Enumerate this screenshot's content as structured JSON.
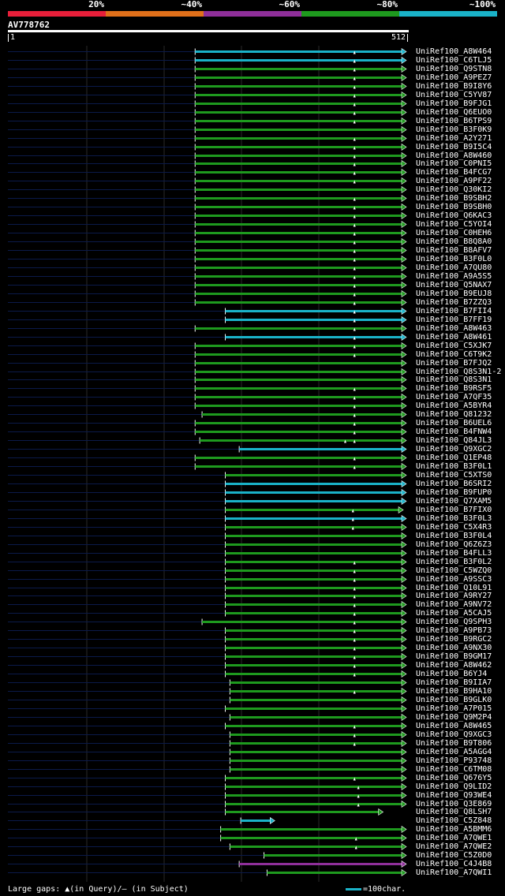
{
  "legend": {
    "segments": [
      {
        "label": "20%",
        "color": "#e81f3a"
      },
      {
        "label": "~40%",
        "color": "#e0701a"
      },
      {
        "label": "~60%",
        "color": "#8f2f9a"
      },
      {
        "label": "~80%",
        "color": "#1e9a1e"
      },
      {
        "label": "~100%",
        "color": "#1ab2c8"
      }
    ]
  },
  "query": {
    "id": "AV778762",
    "start": "1",
    "end": "512",
    "length": 512
  },
  "footer": {
    "gaps_text": "Large gaps: ▲(in Query)/– (in Subject)",
    "scale_text": "=100char."
  },
  "colors": {
    "cyan": "#1ab2c8",
    "green": "#1e9a1e",
    "magenta": "#8f2f9a",
    "gap": "#0b1a4a"
  },
  "hits": [
    {
      "id": "UniRef100_A8W464",
      "s": 242,
      "c": "cyan",
      "m": [
        448
      ]
    },
    {
      "id": "UniRef100_C6TLJ5",
      "s": 242,
      "c": "cyan",
      "m": [
        448
      ]
    },
    {
      "id": "UniRef100_Q9STN8",
      "s": 242,
      "c": "green",
      "m": [
        448
      ]
    },
    {
      "id": "UniRef100_A9PEZ7",
      "s": 242,
      "c": "green",
      "m": [
        448
      ]
    },
    {
      "id": "UniRef100_B9I8Y6",
      "s": 242,
      "c": "green",
      "m": [
        448
      ]
    },
    {
      "id": "UniRef100_C5YV87",
      "s": 242,
      "c": "green",
      "m": [
        448
      ]
    },
    {
      "id": "UniRef100_B9FJG1",
      "s": 242,
      "c": "green",
      "m": [
        448
      ]
    },
    {
      "id": "UniRef100_Q6EUO0",
      "s": 242,
      "c": "green",
      "m": [
        448
      ]
    },
    {
      "id": "UniRef100_B6TPS9",
      "s": 242,
      "c": "green",
      "m": [
        448
      ]
    },
    {
      "id": "UniRef100_B3F0K9",
      "s": 242,
      "c": "green",
      "m": []
    },
    {
      "id": "UniRef100_A2Y271",
      "s": 242,
      "c": "green",
      "m": [
        448
      ]
    },
    {
      "id": "UniRef100_B9I5C4",
      "s": 242,
      "c": "green",
      "m": [
        448
      ]
    },
    {
      "id": "UniRef100_A8W460",
      "s": 242,
      "c": "green",
      "m": [
        448
      ]
    },
    {
      "id": "UniRef100_C0PNI5",
      "s": 242,
      "c": "green",
      "m": [
        448
      ]
    },
    {
      "id": "UniRef100_B4FCG7",
      "s": 242,
      "c": "green",
      "m": [
        448
      ]
    },
    {
      "id": "UniRef100_A9PF22",
      "s": 242,
      "c": "green",
      "m": [
        448
      ]
    },
    {
      "id": "UniRef100_Q30KI2",
      "s": 242,
      "c": "green",
      "m": []
    },
    {
      "id": "UniRef100_B9SBH2",
      "s": 242,
      "c": "green",
      "m": [
        448
      ]
    },
    {
      "id": "UniRef100_B9SBH0",
      "s": 242,
      "c": "green",
      "m": [
        448
      ]
    },
    {
      "id": "UniRef100_Q6KAC3",
      "s": 242,
      "c": "green",
      "m": [
        448
      ]
    },
    {
      "id": "UniRef100_C5YOI4",
      "s": 242,
      "c": "green",
      "m": [
        448
      ]
    },
    {
      "id": "UniRef100_C0HEH6",
      "s": 242,
      "c": "green",
      "m": [
        448
      ]
    },
    {
      "id": "UniRef100_B8Q8A0",
      "s": 242,
      "c": "green",
      "m": [
        448
      ]
    },
    {
      "id": "UniRef100_B8AFV7",
      "s": 242,
      "c": "green",
      "m": [
        448
      ]
    },
    {
      "id": "UniRef100_B3F0L0",
      "s": 242,
      "c": "green",
      "m": [
        448
      ]
    },
    {
      "id": "UniRef100_A7QU80",
      "s": 242,
      "c": "green",
      "m": [
        448
      ]
    },
    {
      "id": "UniRef100_A9A5S5",
      "s": 242,
      "c": "green",
      "m": [
        448
      ]
    },
    {
      "id": "UniRef100_Q5NAX7",
      "s": 242,
      "c": "green",
      "m": [
        448
      ]
    },
    {
      "id": "UniRef100_B9EUJ8",
      "s": 242,
      "c": "green",
      "m": [
        448
      ]
    },
    {
      "id": "UniRef100_B7ZZQ3",
      "s": 242,
      "c": "green",
      "m": [
        448
      ]
    },
    {
      "id": "UniRef100_B7FII4",
      "s": 281,
      "c": "cyan",
      "m": [
        448
      ]
    },
    {
      "id": "UniRef100_B7FF19",
      "s": 281,
      "c": "cyan",
      "m": [
        448
      ]
    },
    {
      "id": "UniRef100_A8W463",
      "s": 242,
      "c": "green",
      "m": [
        448
      ]
    },
    {
      "id": "UniRef100_A8W461",
      "s": 281,
      "c": "cyan",
      "m": [
        448
      ]
    },
    {
      "id": "UniRef100_C5XJK7",
      "s": 242,
      "c": "green",
      "m": [
        448
      ]
    },
    {
      "id": "UniRef100_C6T9K2",
      "s": 242,
      "c": "green",
      "m": [
        448
      ]
    },
    {
      "id": "UniRef100_B7FJQ2",
      "s": 242,
      "c": "green",
      "m": []
    },
    {
      "id": "UniRef100_Q8S3N1-2",
      "s": 242,
      "c": "green",
      "m": []
    },
    {
      "id": "UniRef100_Q8S3N1",
      "s": 242,
      "c": "green",
      "m": []
    },
    {
      "id": "UniRef100_B9RSF5",
      "s": 242,
      "c": "green",
      "m": [
        448
      ]
    },
    {
      "id": "UniRef100_A7QF35",
      "s": 242,
      "c": "green",
      "m": [
        448
      ]
    },
    {
      "id": "UniRef100_A5BYR4",
      "s": 242,
      "c": "green",
      "m": [
        448
      ]
    },
    {
      "id": "UniRef100_Q81232",
      "s": 251,
      "c": "green",
      "m": [
        448
      ]
    },
    {
      "id": "UniRef100_B6UEL6",
      "s": 242,
      "c": "green",
      "m": [
        448
      ]
    },
    {
      "id": "UniRef100_B4FNW4",
      "s": 242,
      "c": "green",
      "m": [
        448
      ]
    },
    {
      "id": "UniRef100_Q84JL3",
      "s": 248,
      "c": "green",
      "m": [
        436,
        448
      ]
    },
    {
      "id": "UniRef100_Q9XGC2",
      "s": 299,
      "c": "cyan",
      "m": []
    },
    {
      "id": "UniRef100_Q1EP48",
      "s": 242,
      "c": "green",
      "m": [
        448
      ]
    },
    {
      "id": "UniRef100_B3F0L1",
      "s": 242,
      "c": "green",
      "m": [
        448
      ]
    },
    {
      "id": "UniRef100_C5XTS0",
      "s": 281,
      "c": "green",
      "m": []
    },
    {
      "id": "UniRef100_B6SRI2",
      "s": 281,
      "c": "cyan",
      "m": []
    },
    {
      "id": "UniRef100_B9FUP0",
      "s": 281,
      "c": "cyan",
      "m": []
    },
    {
      "id": "UniRef100_Q7XAM5",
      "s": 281,
      "c": "cyan",
      "m": []
    },
    {
      "id": "UniRef100_B7FIX0",
      "s": 281,
      "c": "green",
      "e": 508,
      "m": [
        446
      ]
    },
    {
      "id": "UniRef100_B3F0L3",
      "s": 281,
      "c": "cyan",
      "m": [
        446
      ]
    },
    {
      "id": "UniRef100_C5X4R3",
      "s": 281,
      "c": "green",
      "m": [
        446
      ]
    },
    {
      "id": "UniRef100_B3F0L4",
      "s": 281,
      "c": "green",
      "m": []
    },
    {
      "id": "UniRef100_Q6Z6Z3",
      "s": 281,
      "c": "green",
      "m": []
    },
    {
      "id": "UniRef100_B4FLL3",
      "s": 281,
      "c": "green",
      "m": []
    },
    {
      "id": "UniRef100_B3F0L2",
      "s": 281,
      "c": "green",
      "m": [
        448
      ]
    },
    {
      "id": "UniRef100_C5WZQ0",
      "s": 281,
      "c": "green",
      "m": [
        448
      ]
    },
    {
      "id": "UniRef100_A9SSC3",
      "s": 281,
      "c": "green",
      "m": [
        448
      ]
    },
    {
      "id": "UniRef100_Q10L91",
      "s": 281,
      "c": "green",
      "m": [
        448
      ]
    },
    {
      "id": "UniRef100_A9RY27",
      "s": 281,
      "c": "green",
      "m": [
        448
      ]
    },
    {
      "id": "UniRef100_A9NV72",
      "s": 281,
      "c": "green",
      "m": [
        448
      ]
    },
    {
      "id": "UniRef100_A5CAJ5",
      "s": 281,
      "c": "green",
      "m": [
        448
      ]
    },
    {
      "id": "UniRef100_Q9SPH3",
      "s": 251,
      "c": "green",
      "m": [
        448
      ]
    },
    {
      "id": "UniRef100_A9PB73",
      "s": 281,
      "c": "green",
      "m": [
        448
      ]
    },
    {
      "id": "UniRef100_B9RGC2",
      "s": 281,
      "c": "green",
      "m": [
        448
      ]
    },
    {
      "id": "UniRef100_A9NX30",
      "s": 281,
      "c": "green",
      "m": [
        448
      ]
    },
    {
      "id": "UniRef100_B9GM17",
      "s": 281,
      "c": "green",
      "m": [
        448
      ]
    },
    {
      "id": "UniRef100_A8W462",
      "s": 281,
      "c": "green",
      "m": [
        448
      ]
    },
    {
      "id": "UniRef100_B6YJ4",
      "s": 281,
      "c": "green",
      "m": [
        448
      ]
    },
    {
      "id": "UniRef100_B9IIA7",
      "s": 287,
      "c": "green",
      "m": []
    },
    {
      "id": "UniRef100_B9HA10",
      "s": 287,
      "c": "green",
      "m": [
        448
      ]
    },
    {
      "id": "UniRef100_B9GLK0",
      "s": 287,
      "c": "green",
      "m": []
    },
    {
      "id": "UniRef100_A7P015",
      "s": 281,
      "c": "green",
      "m": []
    },
    {
      "id": "UniRef100_Q9M2P4",
      "s": 287,
      "c": "green",
      "m": []
    },
    {
      "id": "UniRef100_A8W465",
      "s": 281,
      "c": "green",
      "m": [
        448
      ]
    },
    {
      "id": "UniRef100_Q9XGC3",
      "s": 287,
      "c": "green",
      "m": [
        448
      ]
    },
    {
      "id": "UniRef100_B9T806",
      "s": 287,
      "c": "green",
      "m": [
        448
      ]
    },
    {
      "id": "UniRef100_A5AGG4",
      "s": 287,
      "c": "green",
      "m": []
    },
    {
      "id": "UniRef100_P93748",
      "s": 287,
      "c": "green",
      "m": []
    },
    {
      "id": "UniRef100_C6TM08",
      "s": 287,
      "c": "green",
      "m": []
    },
    {
      "id": "UniRef100_Q676Y5",
      "s": 281,
      "c": "green",
      "m": [
        448
      ]
    },
    {
      "id": "UniRef100_Q9LID2",
      "s": 281,
      "c": "green",
      "m": [
        453
      ]
    },
    {
      "id": "UniRef100_Q93WE4",
      "s": 281,
      "c": "green",
      "m": [
        453
      ]
    },
    {
      "id": "UniRef100_Q3E869",
      "s": 281,
      "c": "green",
      "m": [
        453
      ]
    },
    {
      "id": "UniRef100_Q8LSH7",
      "s": 281,
      "c": "green",
      "e": 482,
      "m": []
    },
    {
      "id": "UniRef100_C5Z848",
      "s": 301,
      "c": "cyan",
      "e": 342,
      "m": []
    },
    {
      "id": "UniRef100_A5BMM6",
      "s": 275,
      "c": "green",
      "m": []
    },
    {
      "id": "UniRef100_A7QWE1",
      "s": 275,
      "c": "green",
      "m": [
        450
      ]
    },
    {
      "id": "UniRef100_A7QWE2",
      "s": 287,
      "c": "green",
      "m": [
        450
      ]
    },
    {
      "id": "UniRef100_C5Z0D0",
      "s": 331,
      "c": "green",
      "m": []
    },
    {
      "id": "UniRef100_C4J4B8",
      "s": 299,
      "c": "magenta",
      "m": []
    },
    {
      "id": "UniRef100_A7QWI1",
      "s": 335,
      "c": "green",
      "m": []
    }
  ]
}
